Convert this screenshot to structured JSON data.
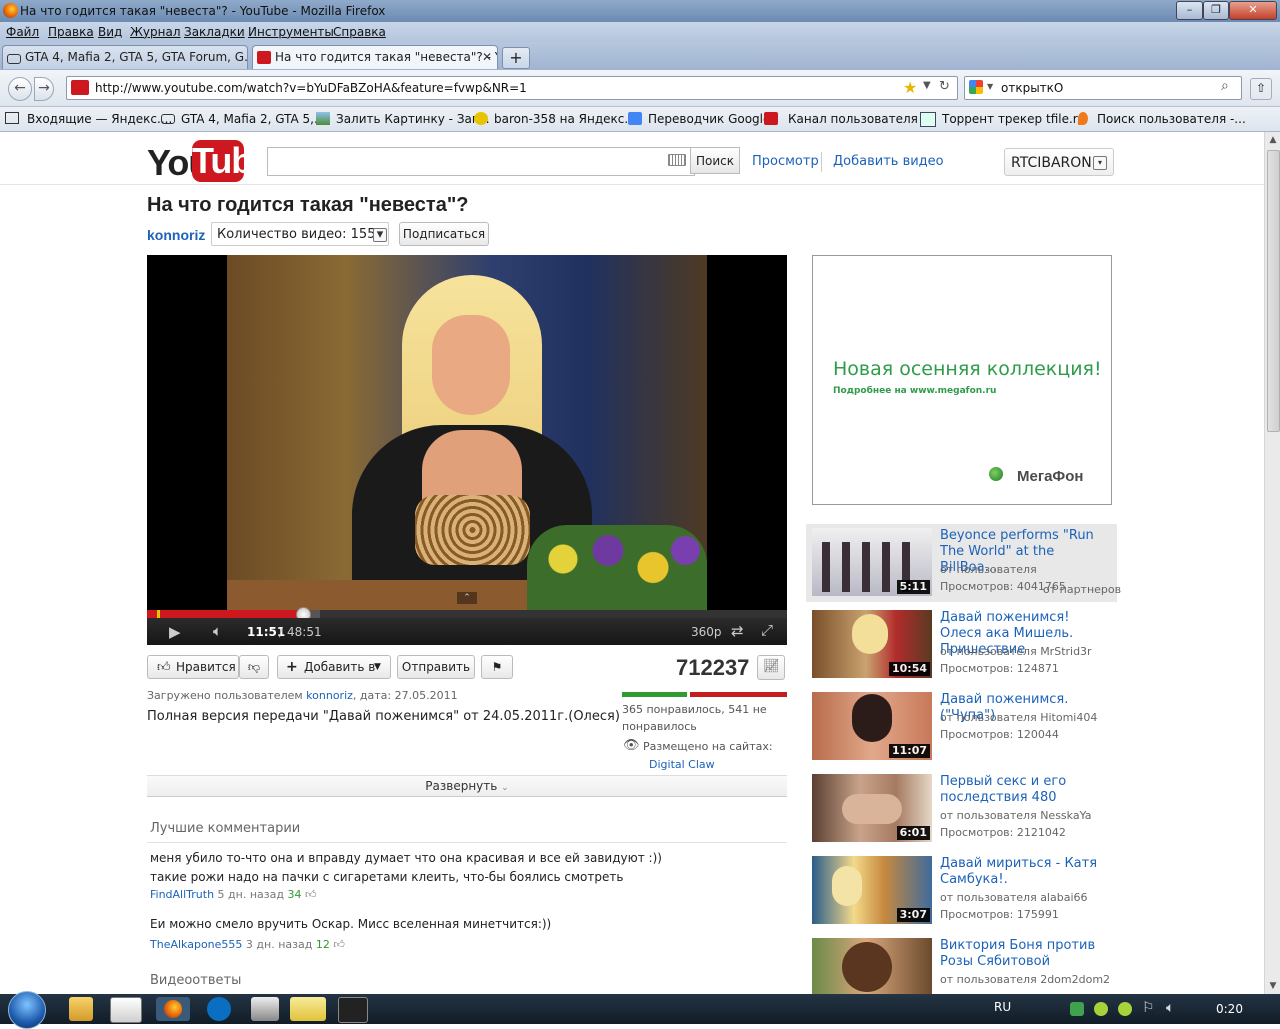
{
  "window": {
    "title": "На что годится такая \"невеста\"? - YouTube - Mozilla Firefox",
    "menu": [
      "Файл",
      "Правка",
      "Вид",
      "Журнал",
      "Закладки",
      "Инструменты",
      "Справка"
    ]
  },
  "tabs": [
    {
      "label": "GTA 4, Mafia 2, GTA 5, GTA Forum, G...",
      "active": false
    },
    {
      "label": "На что годится такая \"невеста\"? - Y...",
      "active": true
    }
  ],
  "navbar": {
    "url": "http://www.youtube.com/watch?v=bYuDFaBZoHA&feature=fvwp&NR=1",
    "search_value": "открыткО"
  },
  "bookmarks": [
    "Входящие — Яндекс....",
    "GTA 4, Mafia 2, GTA 5,...",
    "Залить Картинку - Заг...",
    "baron-358 на Яндекс....",
    "Переводчик Google",
    "Канал пользователя ...",
    "Торрент трекер tfile.r...",
    "Поиск пользователя -..."
  ],
  "youtube": {
    "logo_you": "You",
    "logo_tube": "Tube",
    "search_placeholder": "",
    "search_button": "Поиск",
    "browse": "Просмотр",
    "upload": "Добавить видео",
    "username": "RTCIBARON"
  },
  "video": {
    "title": "На что годится такая \"невеста\"?",
    "channel": "konnoriz",
    "video_count": "Количество видео: 155",
    "subscribe": "Подписаться",
    "time_current": "11:51",
    "time_total": "48:51",
    "quality": "360p",
    "played_fraction": 0.243,
    "loaded_fraction": 0.27,
    "like_label": "Нравится",
    "add_to_label": "Добавить в",
    "share_label": "Отправить",
    "views": "712237",
    "uploaded_prefix": "Загружено пользователем",
    "uploader": "konnoriz",
    "uploaded_date": ", дата: 27.05.2011",
    "description": "Полная версия передачи \"Давай поженимся\" от 24.05.2011г.(Олеся)",
    "likes_text": "365 понравилось, 541 не понравилось",
    "like_fraction": 0.403,
    "embedded_label": "Размещено на сайтах:",
    "embedded_site": "Digital Claw",
    "expand": "Развернуть"
  },
  "comments": {
    "heading": "Лучшие комментарии",
    "items": [
      {
        "line1": "меня убило то-что она и вправду думает что она красивая и все ей завидуют :))",
        "line2": "такие рожи надо на пачки с сигаретами клеить, что-бы боялись смотреть",
        "user": "FindAllTruth",
        "when": " 5 дн. назад ",
        "votes": "34"
      },
      {
        "line1": "Еи можно смело вручить Оскар. Мисс вселенная минетчится:))",
        "line2": "",
        "user": "TheAlkapone555",
        "when": " 3 дн. назад ",
        "votes": "12"
      }
    ],
    "video_responses": "Видеоответы"
  },
  "ad": {
    "headline": "Новая осенняя коллекция!",
    "subline": "Подробнее на www.megafon.ru",
    "brand": "МегаФон"
  },
  "related": [
    {
      "title": "Beyonce performs \"Run The World\" at the BillBoa...",
      "by": "от пользователя",
      "views": "Просмотров: 4041765",
      "extra": "от партнеров",
      "duration": "5:11"
    },
    {
      "title": "Давай поженимся! Олеся ака Мишель. Пришествие",
      "by": "от пользователя MrStrid3r",
      "views": "Просмотров: 124871",
      "extra": "",
      "duration": "10:54"
    },
    {
      "title": "Давай поженимся. (\"Чупа\")",
      "by": "от пользователя Hitomi404",
      "views": "Просмотров: 120044",
      "extra": "",
      "duration": "11:07"
    },
    {
      "title": "Первый секс и его последствия 480",
      "by": "от пользователя NesskaYa",
      "views": "Просмотров: 2121042",
      "extra": "",
      "duration": "6:01"
    },
    {
      "title": "Давай мириться - Катя Самбука!.",
      "by": "от пользователя alabai66",
      "views": "Просмотров: 175991",
      "extra": "",
      "duration": "3:07"
    },
    {
      "title": "Виктория Боня против Розы Сябитовой",
      "by": "от пользователя 2dom2dom2",
      "views": "",
      "extra": "",
      "duration": ""
    }
  ],
  "taskbar": {
    "lang": "RU",
    "time": "0:20"
  }
}
